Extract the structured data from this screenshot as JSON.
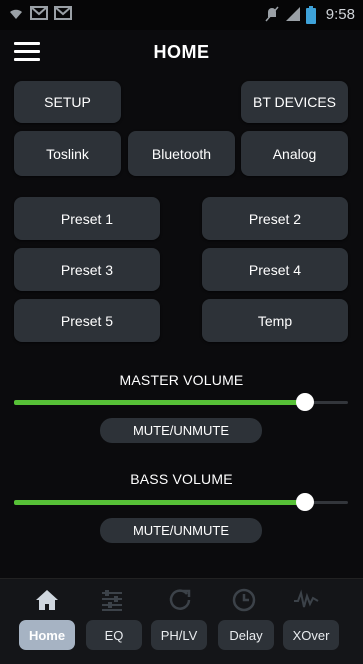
{
  "status_bar": {
    "time": "9:58"
  },
  "header": {
    "title": "HOME"
  },
  "top_buttons": {
    "setup": "SETUP",
    "bt_devices": "BT DEVICES"
  },
  "inputs": {
    "toslink": "Toslink",
    "bluetooth": "Bluetooth",
    "analog": "Analog"
  },
  "presets": [
    "Preset 1",
    "Preset 2",
    "Preset 3",
    "Preset 4",
    "Preset 5",
    "Temp"
  ],
  "master": {
    "label": "MASTER VOLUME",
    "level": 0.87,
    "mute_label": "MUTE/UNMUTE"
  },
  "bass": {
    "label": "BASS VOLUME",
    "level": 0.87,
    "mute_label": "MUTE/UNMUTE"
  },
  "nav": {
    "tabs": [
      "Home",
      "EQ",
      "PH/LV",
      "Delay",
      "XOver"
    ],
    "icons": [
      "home-icon",
      "eq-sliders-icon",
      "refresh-icon",
      "clock-icon",
      "waveform-icon"
    ],
    "active_index": 0
  },
  "colors": {
    "accent_green": "#57c137",
    "button_bg": "#2d3238",
    "active_tab": "#a6b3c3"
  }
}
